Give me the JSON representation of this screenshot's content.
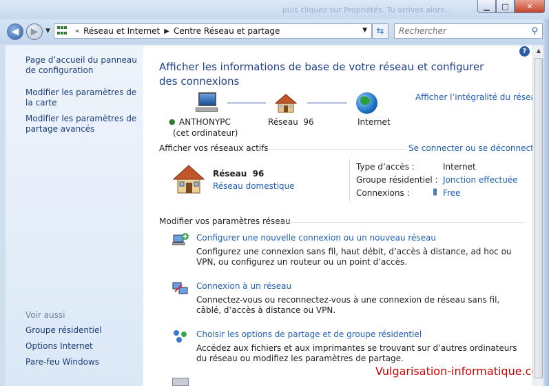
{
  "window": {
    "ghost_title": "puis cliquez sur Propriétés. Tu arrives alors..."
  },
  "address": {
    "crumbs": [
      "Réseau et Internet",
      "Centre Réseau et partage"
    ],
    "search_placeholder": "Rechercher"
  },
  "sidebar": {
    "links": [
      "Page d’accueil du panneau de configuration",
      "Modifier les paramètres de la carte",
      "Modifier les paramètres de partage avancés"
    ],
    "see_also_title": "Voir aussi",
    "see_also": [
      "Groupe résidentiel",
      "Options Internet",
      "Pare-feu Windows"
    ]
  },
  "main": {
    "title": "Afficher les informations de base de votre réseau et configurer des connexions",
    "full_map_link": "Afficher l’intégralité du réseau",
    "map": {
      "computer_name": "ANTHONYPC",
      "computer_sub": "(cet ordinateur)",
      "network": "Réseau  96",
      "internet": "Internet"
    },
    "active_title": "Afficher vos réseaux actifs",
    "connect_link": "Se connecter ou se déconnecter",
    "active_network": {
      "name": "Réseau  96",
      "type_link": "Réseau domestique",
      "access_label": "Type d’accès :",
      "access_value": "Internet",
      "homegroup_label": "Groupe résidentiel :",
      "homegroup_value": "Jonction effectuée",
      "connections_label": "Connexions :",
      "connections_value": "Free"
    },
    "modify_title": "Modifier vos paramètres réseau",
    "tasks": [
      {
        "title": "Configurer une nouvelle connexion ou un nouveau réseau",
        "desc": "Configurez une connexion sans fil, haut débit, d’accès à distance, ad hoc ou VPN, ou configurez un routeur ou un point d’accès."
      },
      {
        "title": "Connexion à un réseau",
        "desc": "Connectez-vous ou reconnectez-vous à une connexion de réseau sans fil, câblé, d’accès à distance ou VPN."
      },
      {
        "title": "Choisir les options de partage et de groupe résidentiel",
        "desc": "Accédez aux fichiers et aux imprimantes se trouvant sur d’autres ordinateurs du réseau ou modifiez les paramètres de partage."
      }
    ],
    "watermark": "Vulgarisation-informatique.com"
  },
  "colors": {
    "link": "#1f5fb3",
    "title": "#1e3e8a",
    "watermark": "#cc0000",
    "sidebar_link": "#1a3c78"
  }
}
